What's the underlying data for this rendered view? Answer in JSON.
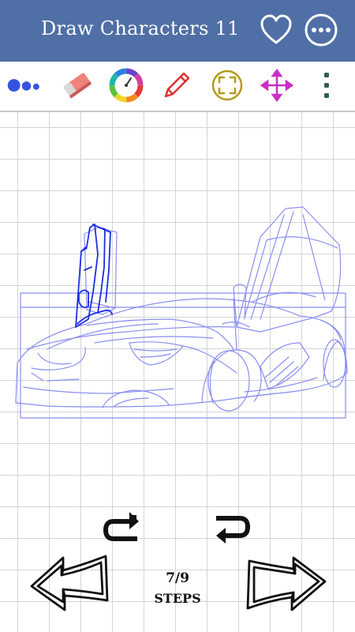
{
  "header": {
    "title": "Draw Characters 11"
  },
  "icons": {
    "favorite": "heart-outline-icon",
    "more": "more-horizontal-icon",
    "brush_size": "brush-size-dots-icon",
    "eraser": "eraser-icon",
    "color": "color-wheel-icon",
    "pencil": "pencil-icon",
    "fit": "fit-screen-icon",
    "move": "move-arrows-icon",
    "menu": "more-vertical-icon",
    "redo": "redo-icon",
    "undo": "undo-icon",
    "prev": "previous-arrow-icon",
    "next": "next-arrow-icon"
  },
  "colors": {
    "header_bg": "#4f6fa6",
    "brush": "#3454e0",
    "eraser": "#f0837c",
    "pencil": "#e03131",
    "fit": "#b59a1c",
    "move": "#c82ec6",
    "menu": "#2e5d59",
    "sketch_line": "#8a8ef0",
    "current_step_line": "#1b2fe0"
  },
  "steps": {
    "current": 7,
    "total": 9,
    "count_text": "7/9",
    "label": "STEPS"
  }
}
